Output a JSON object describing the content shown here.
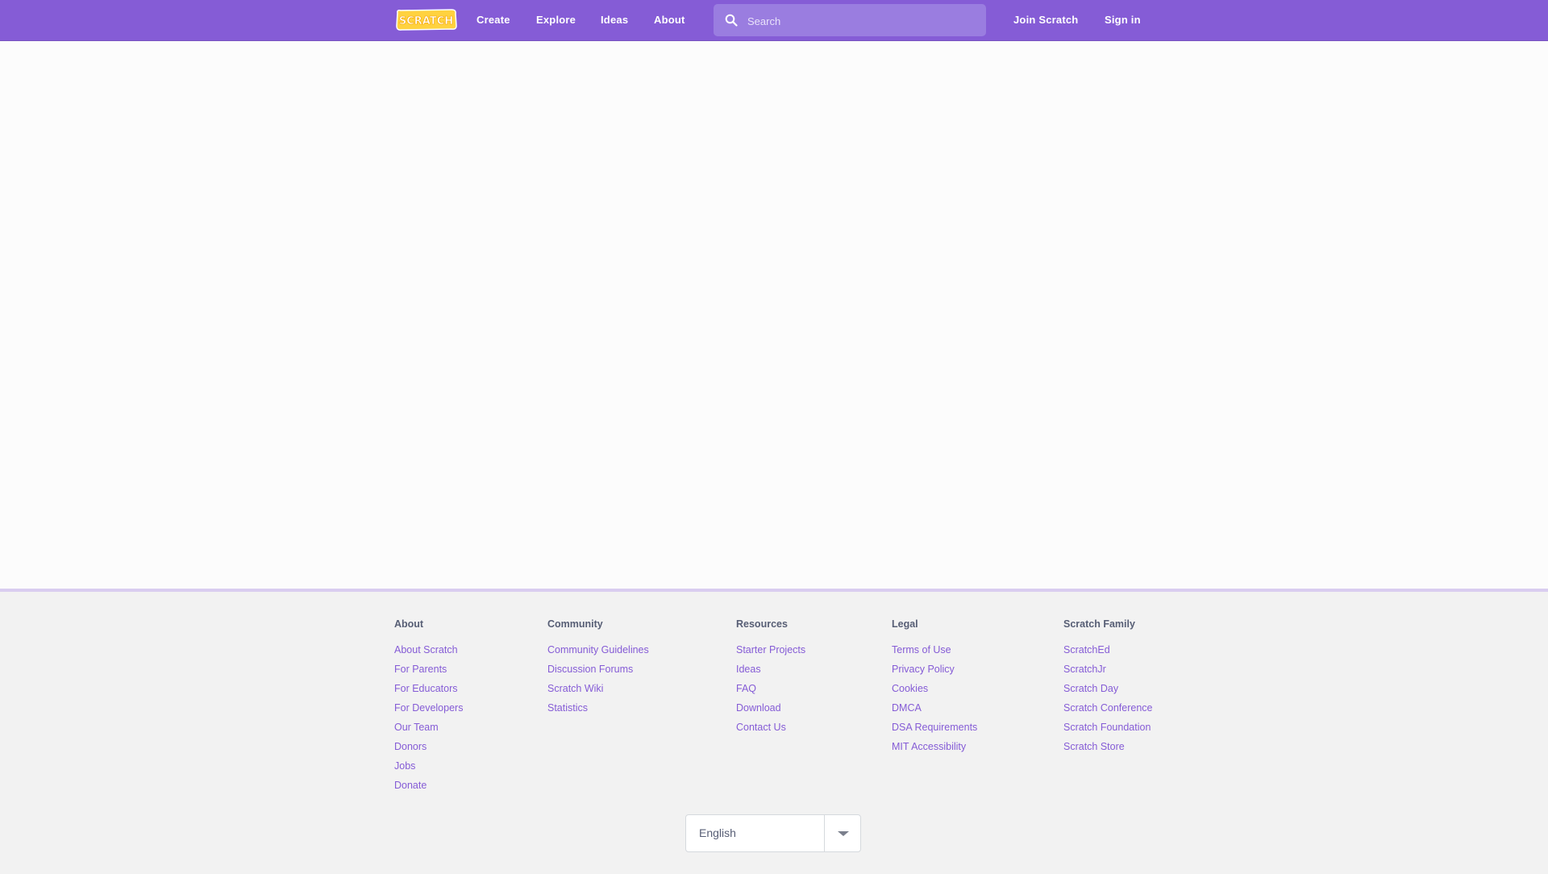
{
  "header": {
    "logo_text": "SCRATCH",
    "nav": [
      {
        "label": "Create"
      },
      {
        "label": "Explore"
      },
      {
        "label": "Ideas"
      },
      {
        "label": "About"
      }
    ],
    "search": {
      "placeholder": "Search"
    },
    "join_label": "Join Scratch",
    "signin_label": "Sign in",
    "colors": {
      "bar": "#855cd6",
      "search_bg": "#9a7de0",
      "logo_fill": "#ffd23f",
      "logo_text": "#ffffff"
    }
  },
  "footer": {
    "columns": [
      {
        "heading": "About",
        "links": [
          "About Scratch",
          "For Parents",
          "For Educators",
          "For Developers",
          "Our Team",
          "Donors",
          "Jobs",
          "Donate"
        ]
      },
      {
        "heading": "Community",
        "links": [
          "Community Guidelines",
          "Discussion Forums",
          "Scratch Wiki",
          "Statistics"
        ]
      },
      {
        "heading": "Resources",
        "links": [
          "Starter Projects",
          "Ideas",
          "FAQ",
          "Download",
          "Contact Us"
        ]
      },
      {
        "heading": "Legal",
        "links": [
          "Terms of Use",
          "Privacy Policy",
          "Cookies",
          "DMCA",
          "DSA Requirements",
          "MIT Accessibility"
        ]
      },
      {
        "heading": "Scratch Family",
        "links": [
          "ScratchEd",
          "ScratchJr",
          "Scratch Day",
          "Scratch Conference",
          "Scratch Foundation",
          "Scratch Store"
        ]
      }
    ],
    "language": {
      "selected": "English"
    },
    "colors": {
      "link": "#855cd6",
      "heading": "#575e75",
      "background": "#f2f2f2"
    }
  }
}
